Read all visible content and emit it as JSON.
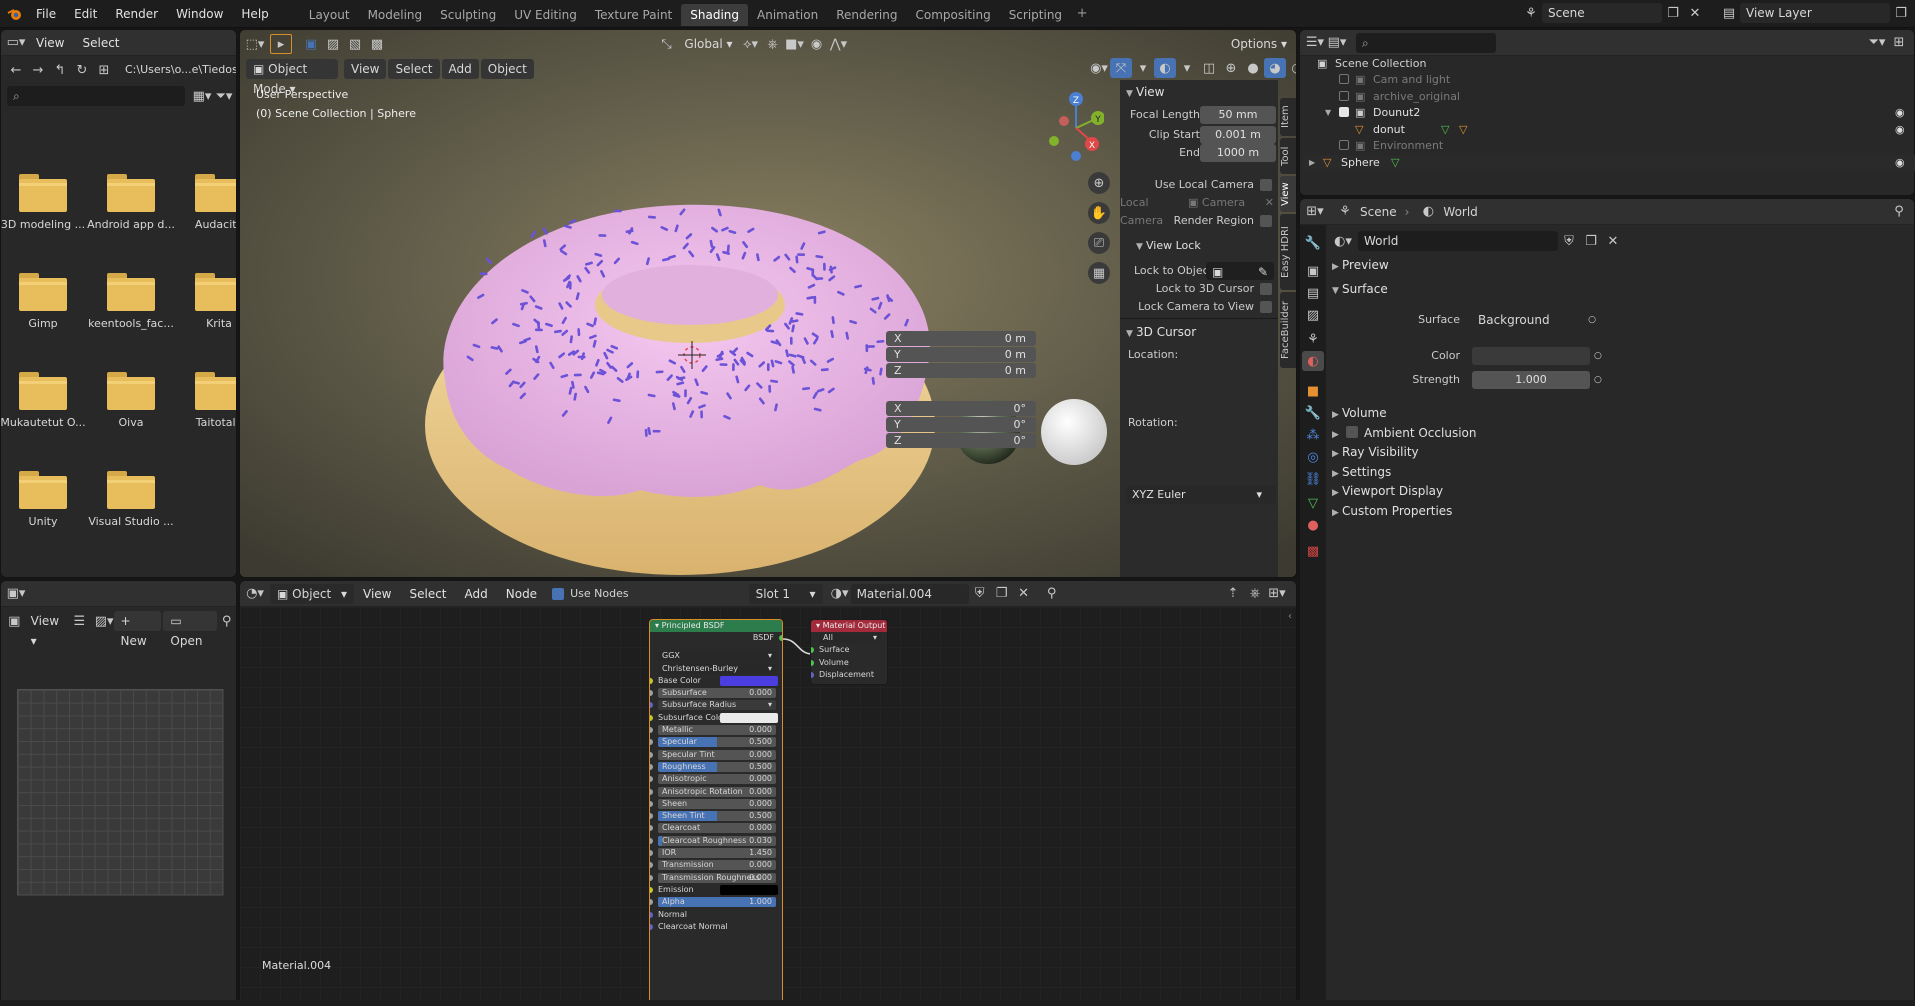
{
  "menu": [
    "File",
    "Edit",
    "Render",
    "Window",
    "Help"
  ],
  "workspaces": [
    "Layout",
    "Modeling",
    "Sculpting",
    "UV Editing",
    "Texture Paint",
    "Shading",
    "Animation",
    "Rendering",
    "Compositing",
    "Scripting"
  ],
  "active_workspace": "Shading",
  "scene_name": "Scene",
  "view_layer": "View Layer",
  "filebrowser": {
    "menu": [
      "View",
      "Select"
    ],
    "path": "C:\\Users\\o...e\\Tiedostot\\",
    "items": [
      "3D modeling ...",
      "Android app d...",
      "Audacity",
      "Gimp",
      "keentools_fac...",
      "Krita",
      "Mukautetut O...",
      "Oiva",
      "Taitotalo",
      "Unity",
      "Visual Studio ..."
    ]
  },
  "viewport": {
    "mode": "Object Mode",
    "menu": [
      "View",
      "Select",
      "Add",
      "Object"
    ],
    "transform": "Global",
    "options": "Options",
    "overlay_line1": "User Perspective",
    "overlay_line2": "(0) Scene Collection | Sphere",
    "gizmo": {
      "x": "X",
      "y": "Y",
      "z": "Z"
    }
  },
  "npanel": {
    "tabs": [
      "Item",
      "Tool",
      "View",
      "Easy HDRI",
      "FaceBuilder"
    ],
    "view_title": "View",
    "focal_label": "Focal Length",
    "focal": "50 mm",
    "clip_start_label": "Clip Start",
    "clip_start": "0.001 m",
    "end_label": "End",
    "end": "1000 m",
    "use_local_camera": "Use Local Camera",
    "local_camera_label": "Local Camera",
    "camera": "Camera",
    "render_region": "Render Region",
    "view_lock_title": "View Lock",
    "lock_to_object": "Lock to Object",
    "lock_to_cursor": "Lock to 3D Cursor",
    "lock_camera": "Lock Camera to View",
    "cursor_title": "3D Cursor",
    "location_label": "Location:",
    "loc": [
      {
        "axis": "X",
        "value": "0 m"
      },
      {
        "axis": "Y",
        "value": "0 m"
      },
      {
        "axis": "Z",
        "value": "0 m"
      }
    ],
    "rotation_label": "Rotation:",
    "rot": [
      {
        "axis": "X",
        "value": "0°"
      },
      {
        "axis": "Y",
        "value": "0°"
      },
      {
        "axis": "Z",
        "value": "0°"
      }
    ],
    "rotation_mode": "XYZ Euler"
  },
  "image_editor": {
    "view": "View",
    "new": "New",
    "open": "Open"
  },
  "node_editor": {
    "type": "Object",
    "menu": [
      "View",
      "Select",
      "Add",
      "Node"
    ],
    "use_nodes": "Use Nodes",
    "slot": "Slot 1",
    "material": "Material.004",
    "tree_label": "Material.004",
    "bsdf": {
      "title": "Principled BSDF",
      "output": "BSDF",
      "distribution": "GGX",
      "sss_method": "Christensen-Burley",
      "base_color_label": "Base Color",
      "base_color": "#4a3ee0",
      "subsurface_color_label": "Subsurface Color",
      "emission_label": "Emission",
      "sss_radius_label": "Subsurface Radius",
      "normal": "Normal",
      "clearcoat_normal": "Clearcoat Normal",
      "inputs": [
        {
          "label": "Subsurface",
          "value": "0.000",
          "fill": 0
        },
        {
          "label": "Metallic",
          "value": "0.000",
          "fill": 0
        },
        {
          "label": "Specular",
          "value": "0.500",
          "fill": 0.5
        },
        {
          "label": "Specular Tint",
          "value": "0.000",
          "fill": 0
        },
        {
          "label": "Roughness",
          "value": "0.500",
          "fill": 0.5
        },
        {
          "label": "Anisotropic",
          "value": "0.000",
          "fill": 0
        },
        {
          "label": "Anisotropic Rotation",
          "value": "0.000",
          "fill": 0
        },
        {
          "label": "Sheen",
          "value": "0.000",
          "fill": 0
        },
        {
          "label": "Sheen Tint",
          "value": "0.500",
          "fill": 0.5
        },
        {
          "label": "Clearcoat",
          "value": "0.000",
          "fill": 0
        },
        {
          "label": "Clearcoat Roughness",
          "value": "0.030",
          "fill": 0.03
        },
        {
          "label": "IOR",
          "value": "1.450",
          "fill": 0
        },
        {
          "label": "Transmission",
          "value": "0.000",
          "fill": 0
        },
        {
          "label": "Transmission Roughness",
          "value": "0.000",
          "fill": 0
        },
        {
          "label": "Alpha",
          "value": "1.000",
          "fill": 1
        }
      ]
    },
    "output": {
      "title": "Material Output",
      "target": "All",
      "sockets": [
        "Surface",
        "Volume",
        "Displacement"
      ]
    }
  },
  "outliner": {
    "root": "Scene Collection",
    "items": [
      {
        "name": "Cam and light",
        "dim": true
      },
      {
        "name": "archive_original",
        "dim": true
      },
      {
        "name": "Dounut2",
        "dim": false
      },
      {
        "name": "donut",
        "dim": false
      },
      {
        "name": "Environment",
        "dim": true
      },
      {
        "name": "Sphere",
        "dim": false
      }
    ]
  },
  "properties": {
    "scene": "Scene",
    "world": "World",
    "world_name": "World",
    "preview": "Preview",
    "surface_section": "Surface",
    "surface_label": "Surface",
    "surface_value": "Background",
    "color_label": "Color",
    "strength_label": "Strength",
    "strength": "1.000",
    "sections": [
      "Volume",
      "Ambient Occlusion",
      "Ray Visibility",
      "Settings",
      "Viewport Display",
      "Custom Properties"
    ]
  },
  "colors": {
    "accent": "#4772b3",
    "frosting": "#d9a3d6",
    "sprinkle": "#6b52d6",
    "bsdf_header": "#2d7d4c",
    "output_header": "#a22a3a"
  }
}
